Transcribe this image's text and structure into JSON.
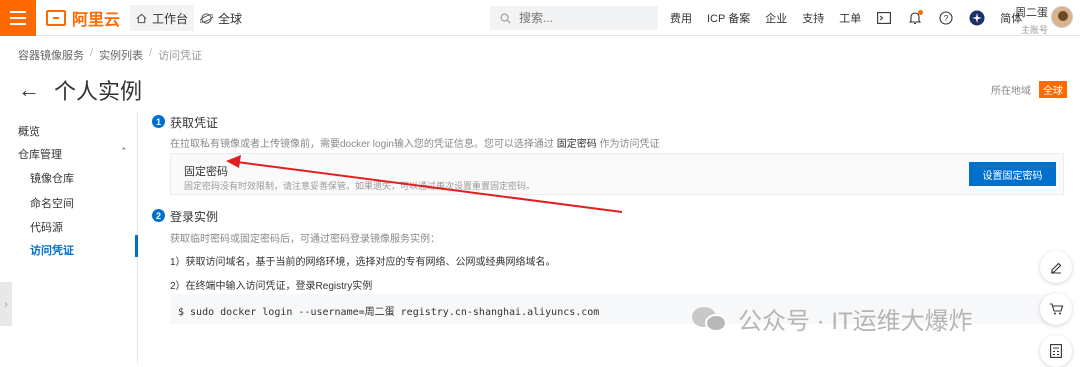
{
  "topbar": {
    "logo_text": "阿里云",
    "workbench_label": "工作台",
    "global_label": "全球",
    "search_placeholder": "搜索...",
    "links": [
      "费用",
      "ICP 备案",
      "企业",
      "支持",
      "工单"
    ],
    "language": "简体",
    "user_name": "周二蛋",
    "user_role": "主账号",
    "brand_color": "#ff6a00"
  },
  "breadcrumb": [
    "容器镜像服务",
    "实例列表",
    "访问凭证"
  ],
  "page": {
    "title": "个人实例",
    "region_label": "所在地域",
    "region_value": "全球"
  },
  "sidebar": {
    "items": [
      "概览",
      "仓库管理",
      "镜像仓库",
      "命名空间",
      "代码源",
      "访问凭证"
    ],
    "active": "访问凭证"
  },
  "step1": {
    "number": "1",
    "title": "获取凭证",
    "desc_prefix": "在拉取私有镜像或者上传镜像前，需要docker login输入您的凭证信息。您可以选择通过",
    "desc_highlight": "固定密码",
    "desc_suffix": "作为访问凭证",
    "card_title": "固定密码",
    "card_desc": "固定密码没有时效限制，请注意妥善保管。如果遗失，可以通过再次设置重置固定密码。",
    "button_label": "设置固定密码"
  },
  "step2": {
    "number": "2",
    "title": "登录实例",
    "desc": "获取临时密码或固定密码后，可通过密码登录镜像服务实例：",
    "line1": "1）获取访问域名，基于当前的网络环境，选择对应的专有网络、公网或经典网络域名。",
    "line2": "2）在终端中输入访问凭证，登录Registry实例",
    "command": "$ sudo docker login --username=周二蛋 registry.cn-shanghai.aliyuncs.com"
  },
  "watermark": {
    "text": "公众号 · IT运维大爆炸"
  },
  "colors": {
    "primary": "#0070cc",
    "annotation_arrow": "#e02020"
  }
}
